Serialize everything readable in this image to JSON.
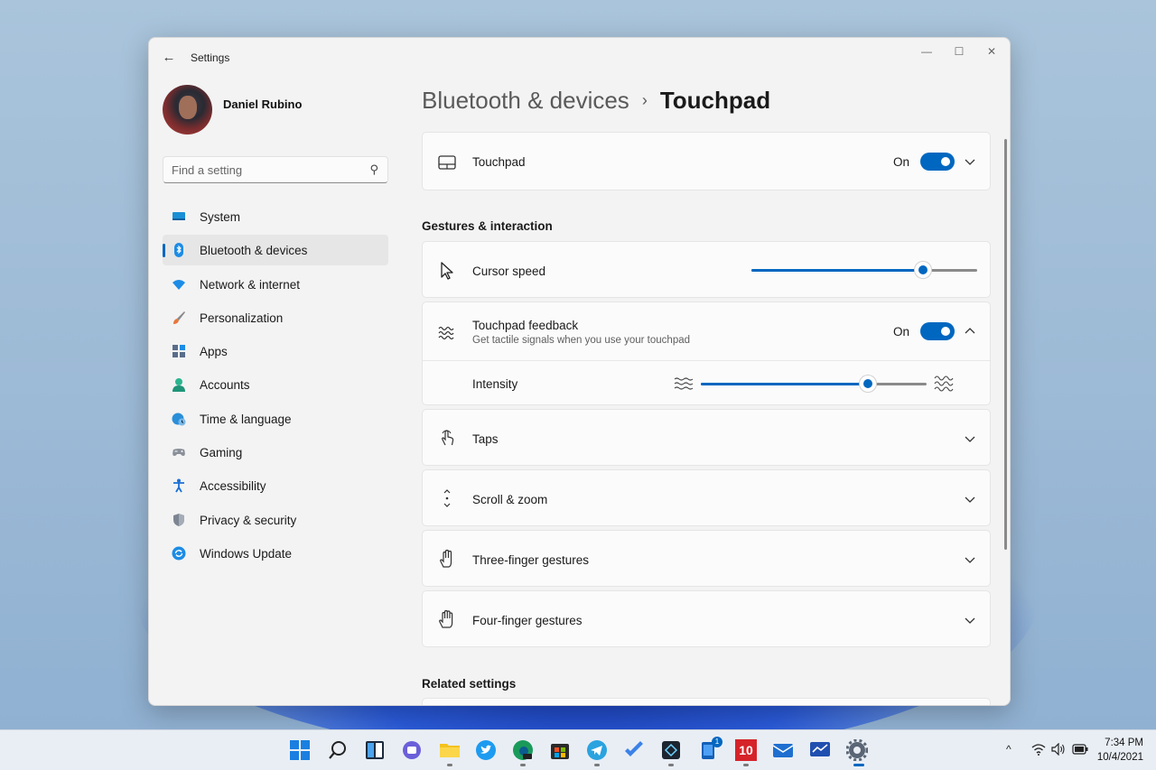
{
  "window": {
    "app_title": "Settings",
    "back_icon": "back-arrow-icon",
    "controls": {
      "minimize": "—",
      "maximize": "☐",
      "close": "✕"
    }
  },
  "profile": {
    "name": "Daniel Rubino"
  },
  "search": {
    "placeholder": "Find a setting"
  },
  "sidebar": {
    "items": [
      {
        "label": "System",
        "icon": "system-icon",
        "active": false
      },
      {
        "label": "Bluetooth & devices",
        "icon": "bluetooth-icon",
        "active": true
      },
      {
        "label": "Network & internet",
        "icon": "wifi-icon",
        "active": false
      },
      {
        "label": "Personalization",
        "icon": "brush-icon",
        "active": false
      },
      {
        "label": "Apps",
        "icon": "apps-icon",
        "active": false
      },
      {
        "label": "Accounts",
        "icon": "person-icon",
        "active": false
      },
      {
        "label": "Time & language",
        "icon": "globe-clock-icon",
        "active": false
      },
      {
        "label": "Gaming",
        "icon": "gamepad-icon",
        "active": false
      },
      {
        "label": "Accessibility",
        "icon": "accessibility-icon",
        "active": false
      },
      {
        "label": "Privacy & security",
        "icon": "shield-icon",
        "active": false
      },
      {
        "label": "Windows Update",
        "icon": "update-icon",
        "active": false
      }
    ]
  },
  "breadcrumb": {
    "parent": "Bluetooth & devices",
    "separator": "›",
    "current": "Touchpad"
  },
  "touchpad_card": {
    "label": "Touchpad",
    "state": "On",
    "enabled": true
  },
  "gestures_section": {
    "title": "Gestures & interaction"
  },
  "cursor_speed": {
    "label": "Cursor speed",
    "value_fraction": 0.76
  },
  "feedback": {
    "label": "Touchpad feedback",
    "description": "Get tactile signals when you use your touchpad",
    "state": "On",
    "enabled": true,
    "intensity_label": "Intensity",
    "intensity_fraction": 0.74
  },
  "rows": [
    {
      "label": "Taps",
      "icon": "tap-icon"
    },
    {
      "label": "Scroll & zoom",
      "icon": "scroll-icon"
    },
    {
      "label": "Three-finger gestures",
      "icon": "hand-three-finger-icon"
    },
    {
      "label": "Four-finger gestures",
      "icon": "hand-four-finger-icon"
    }
  ],
  "related_section": {
    "title": "Related settings"
  },
  "taskbar": {
    "time": "7:34 PM",
    "date": "10/4/2021",
    "notification_count": "1",
    "news_badge": "10",
    "colors": {
      "accent": "#0067c0"
    }
  }
}
